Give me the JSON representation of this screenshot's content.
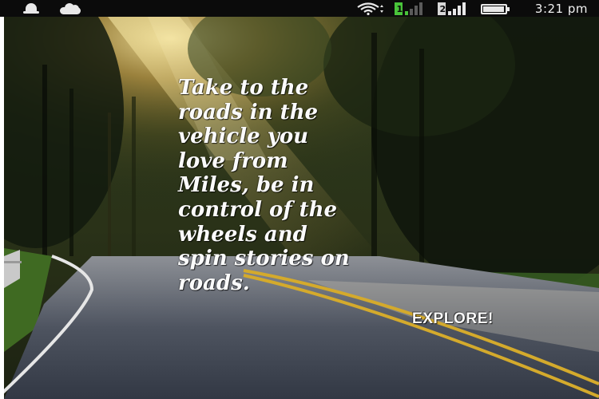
{
  "status_bar": {
    "icons": [
      "notification-bell-icon",
      "cloud-sync-icon",
      "wifi-icon",
      "sim-1-signal-icon",
      "sim-2-signal-icon",
      "battery-icon"
    ],
    "sim1_label": "1",
    "sim2_label": "2",
    "time": "3:21 pm"
  },
  "hero": {
    "background": "sunlit-forest-road-image",
    "tagline": "Take to the\nroads in the\nvehicle you\nlove from\nMiles,  be in\ncontrol of the\nwheels and\nspin stories on\nroads.",
    "explore_label": "EXPLORE!"
  },
  "colors": {
    "status_bar_bg": "#0b0b0b",
    "text": "#fbfbfb",
    "sim1_accent": "#49c43a"
  }
}
